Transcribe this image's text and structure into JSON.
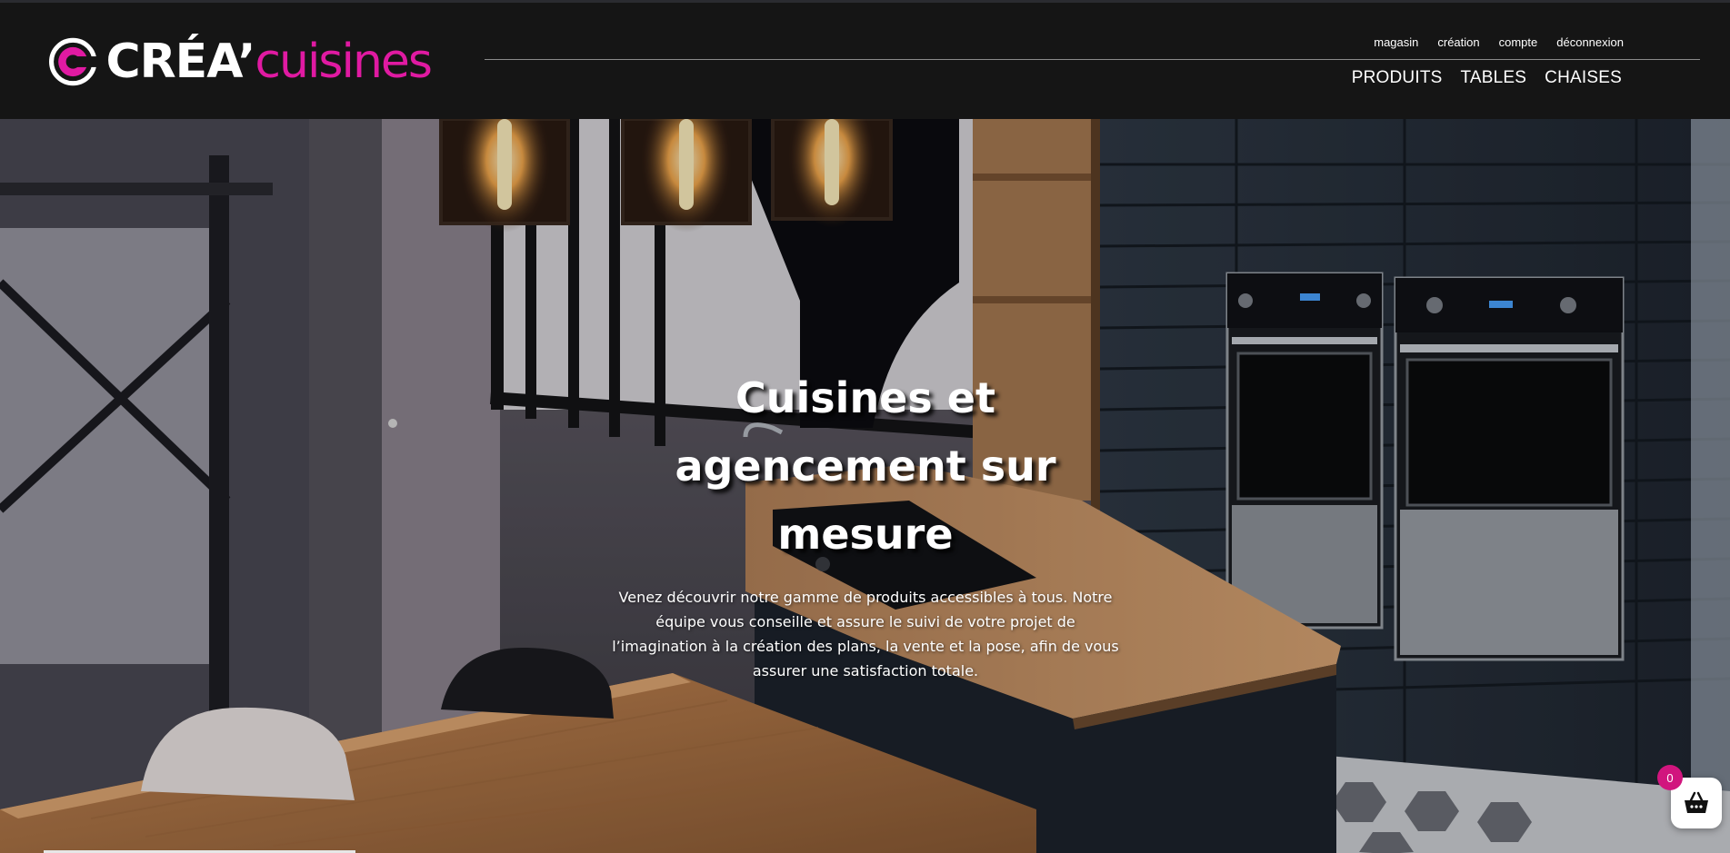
{
  "brand": {
    "name_part1": "CRÉA’",
    "name_part2": "cuisines",
    "accent_color": "#e01aa2"
  },
  "nav": {
    "top_links": [
      "magasin",
      "création",
      "compte",
      "déconnexion"
    ],
    "main_links": [
      "PRODUITS",
      "TABLES",
      "CHAISES"
    ]
  },
  "hero": {
    "title": "Cuisines et agencement sur mesure",
    "text": "Venez découvrir notre gamme de produits accessibles à tous. Notre équipe vous conseille et assure le suivi de votre projet de l’imagination à la création des plans, la vente et la pose, afin de vous assurer une satisfaction totale."
  },
  "cart": {
    "count": "0",
    "icon": "basket-icon",
    "badge_color": "#d1157e"
  }
}
